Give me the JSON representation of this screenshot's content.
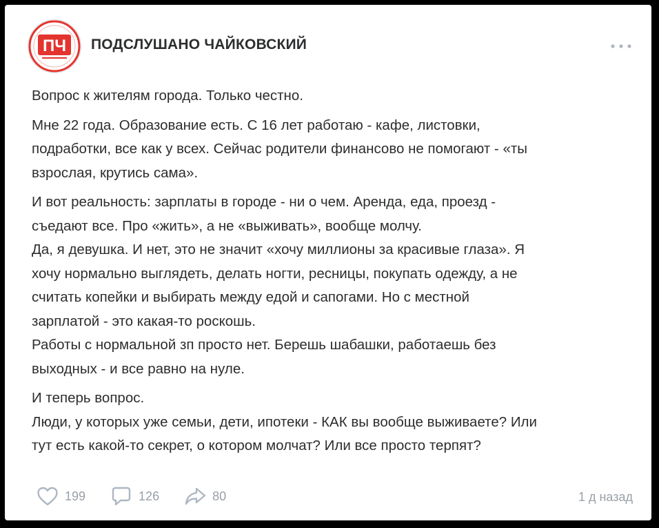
{
  "group": {
    "name": "ПОДСЛУШАНО ЧАЙКОВСКИЙ",
    "avatar_text": "ПЧ",
    "avatar_color": "#e3342f"
  },
  "post": {
    "paragraphs": [
      "Вопрос к жителям города. Только честно.",
      "Мне 22 года. Образование есть. С 16 лет работаю - кафе, листовки,\nподработки, все как у всех. Сейчас родители финансово не помогают - «ты\nвзрослая, крутись сама».",
      "И вот реальность: зарплаты в городе - ни о чем. Аренда, еда, проезд -\nсъедают все. Про «жить», а не «выживать», вообще молчу.\nДа, я девушка. И нет, это не значит «хочу миллионы за красивые глаза». Я\nхочу нормально выглядеть, делать ногти, ресницы, покупать одежду, а не\nсчитать копейки и выбирать между едой и сапогами. Но с местной\nзарплатой - это какая-то роскошь.\nРаботы с нормальной зп просто нет. Берешь шабашки, работаешь без\nвыходных - и все равно на нуле.",
      "И теперь вопрос.\nЛюди, у которых уже семьи, дети, ипотеки - КАК вы вообще выживаете? Или\nтут есть какой-то секрет, о котором молчат? Или все просто терпят?"
    ]
  },
  "actions": {
    "likes": "199",
    "comments": "126",
    "shares": "80"
  },
  "timestamp": "1 д назад",
  "icons": {
    "more": "more-dots-icon",
    "like": "heart-icon",
    "comment": "comment-icon",
    "share": "share-icon"
  },
  "colors": {
    "text": "#2c2d2e",
    "secondary": "#9aa0a8",
    "icon": "#aeb7c2"
  }
}
